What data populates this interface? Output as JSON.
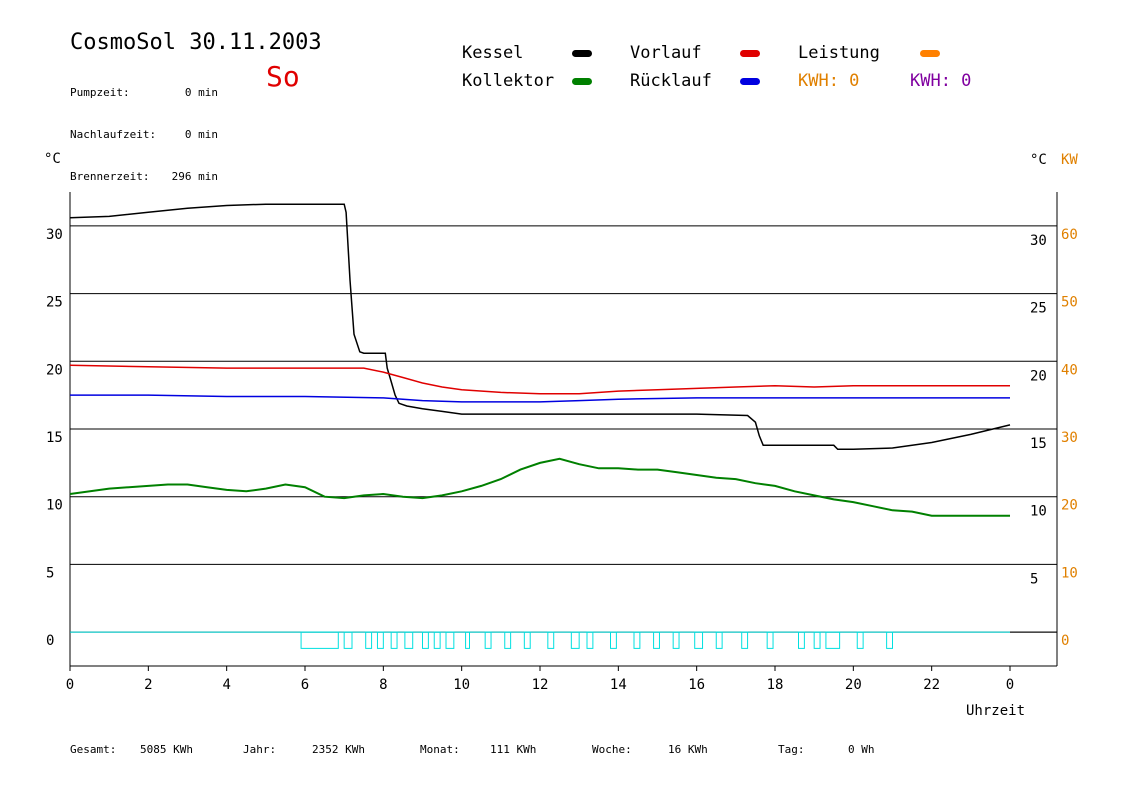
{
  "header": {
    "title": "CosmoSol 30.11.2003",
    "day": "So",
    "day_color": "#e00000",
    "stats": [
      {
        "label": "Pumpzeit:",
        "value": "0 min"
      },
      {
        "label": "Nachlaufzeit:",
        "value": "0 min"
      },
      {
        "label": "Brennerzeit:",
        "value": "296 min"
      }
    ]
  },
  "legend": {
    "items": [
      {
        "label": "Kessel",
        "color": "#000000"
      },
      {
        "label": "Vorlauf",
        "color": "#e00000"
      },
      {
        "label": "Leistung",
        "color": "#ff8000"
      },
      {
        "label": "Kollektor",
        "color": "#008000"
      },
      {
        "label": "Rücklauf",
        "color": "#0000e0"
      }
    ],
    "kwh1": {
      "label": "KWH: 0",
      "color": "#e08000"
    },
    "kwh2": {
      "label": "KWH: 0",
      "color": "#8000a0"
    }
  },
  "totals": [
    {
      "label": "Gesamt:",
      "value": "5085 KWh"
    },
    {
      "label": "Jahr:",
      "value": "2352 KWh"
    },
    {
      "label": "Monat:",
      "value": "111 KWh"
    },
    {
      "label": "Woche:",
      "value": "16 KWh"
    },
    {
      "label": "Tag:",
      "value": "0 Wh"
    }
  ],
  "chart_data": {
    "type": "line",
    "xlabel": "Uhrzeit",
    "ylabel_left": "°C",
    "ylabel_right": "°C",
    "ylabel_right2": "KW",
    "xlim": [
      0,
      24
    ],
    "ylim": [
      -2.5,
      32.5
    ],
    "y2lim": [
      -5,
      65
    ],
    "x_ticks": [
      0,
      2,
      4,
      6,
      8,
      10,
      12,
      14,
      16,
      18,
      20,
      22,
      24
    ],
    "x_tick_labels": [
      "0",
      "2",
      "4",
      "6",
      "8",
      "10",
      "12",
      "14",
      "16",
      "18",
      "20",
      "22",
      "0"
    ],
    "y_ticks": [
      0,
      5,
      10,
      15,
      20,
      25,
      30
    ],
    "y2_ticks": [
      0,
      10,
      20,
      30,
      40,
      50,
      60
    ],
    "grid": true,
    "colors": {
      "kw_axis": "#e08000"
    },
    "series": [
      {
        "name": "Kessel",
        "color": "#000000",
        "x": [
          0,
          1,
          2,
          3,
          4,
          5,
          6,
          7.0,
          7.05,
          7.15,
          7.25,
          7.4,
          7.5,
          8.05,
          8.1,
          8.2,
          8.3,
          8.4,
          8.6,
          9.0,
          9.5,
          10,
          12,
          14,
          16,
          17.3,
          17.5,
          17.6,
          17.7,
          18,
          19,
          19.5,
          19.6,
          20,
          21,
          22,
          23,
          24
        ],
        "y": [
          30.6,
          30.7,
          31.0,
          31.3,
          31.5,
          31.6,
          31.6,
          31.6,
          31.0,
          26,
          22,
          20.7,
          20.6,
          20.6,
          19.5,
          18.5,
          17.5,
          16.9,
          16.7,
          16.5,
          16.3,
          16.1,
          16.1,
          16.1,
          16.1,
          16.0,
          15.5,
          14.5,
          13.8,
          13.8,
          13.8,
          13.8,
          13.5,
          13.5,
          13.6,
          14.0,
          14.6,
          15.3
        ]
      },
      {
        "name": "Vorlauf",
        "color": "#e00000",
        "x": [
          0,
          2,
          4,
          6,
          7,
          7.5,
          8,
          8.5,
          9,
          9.5,
          10,
          11,
          12,
          13,
          14,
          15,
          16,
          17,
          18,
          19,
          20,
          21,
          22,
          23,
          24
        ],
        "y": [
          19.7,
          19.6,
          19.5,
          19.5,
          19.5,
          19.5,
          19.2,
          18.8,
          18.4,
          18.1,
          17.9,
          17.7,
          17.6,
          17.6,
          17.8,
          17.9,
          18.0,
          18.1,
          18.2,
          18.1,
          18.2,
          18.2,
          18.2,
          18.2,
          18.2
        ]
      },
      {
        "name": "Rücklauf",
        "color": "#0000e0",
        "x": [
          0,
          2,
          4,
          6,
          8,
          8.5,
          9,
          10,
          11,
          12,
          13,
          14,
          16,
          18,
          20,
          22,
          24
        ],
        "y": [
          17.5,
          17.5,
          17.4,
          17.4,
          17.3,
          17.2,
          17.1,
          17.0,
          17.0,
          17.0,
          17.1,
          17.2,
          17.3,
          17.3,
          17.3,
          17.3,
          17.3
        ]
      },
      {
        "name": "Kollektor",
        "color": "#008000",
        "x": [
          0,
          1,
          2,
          2.5,
          3,
          3.5,
          4,
          4.5,
          5,
          5.5,
          6,
          6.5,
          7,
          7.5,
          8,
          8.5,
          9,
          9.5,
          10,
          10.5,
          11,
          11.5,
          12,
          12.5,
          13,
          13.5,
          14,
          14.5,
          15,
          15.5,
          16,
          16.5,
          17,
          17.5,
          18,
          18.5,
          19,
          19.5,
          20,
          20.5,
          21,
          21.5,
          22,
          22.5,
          23,
          23.5,
          24
        ],
        "y": [
          10.2,
          10.6,
          10.8,
          10.9,
          10.9,
          10.7,
          10.5,
          10.4,
          10.6,
          10.9,
          10.7,
          10.0,
          9.9,
          10.1,
          10.2,
          10.0,
          9.9,
          10.1,
          10.4,
          10.8,
          11.3,
          12.0,
          12.5,
          12.8,
          12.4,
          12.1,
          12.1,
          12.0,
          12.0,
          11.8,
          11.6,
          11.4,
          11.3,
          11.0,
          10.8,
          10.4,
          10.1,
          9.8,
          9.6,
          9.3,
          9.0,
          8.9,
          8.6,
          8.6,
          8.6,
          8.6,
          8.6
        ]
      }
    ],
    "pump_pulses": {
      "name": "Pumpe",
      "color": "#00e0e0",
      "baseline": 0,
      "height": -1.2,
      "intervals": [
        [
          5.9,
          6.85
        ],
        [
          7.0,
          7.2
        ],
        [
          7.55,
          7.7
        ],
        [
          7.85,
          8.0
        ],
        [
          8.2,
          8.35
        ],
        [
          8.55,
          8.75
        ],
        [
          9.0,
          9.15
        ],
        [
          9.3,
          9.45
        ],
        [
          9.6,
          9.8
        ],
        [
          10.1,
          10.2
        ],
        [
          10.6,
          10.75
        ],
        [
          11.1,
          11.25
        ],
        [
          11.6,
          11.75
        ],
        [
          12.2,
          12.35
        ],
        [
          12.8,
          13.0
        ],
        [
          13.2,
          13.35
        ],
        [
          13.8,
          13.95
        ],
        [
          14.4,
          14.55
        ],
        [
          14.9,
          15.05
        ],
        [
          15.4,
          15.55
        ],
        [
          15.95,
          16.15
        ],
        [
          16.5,
          16.65
        ],
        [
          17.15,
          17.3
        ],
        [
          17.8,
          17.95
        ],
        [
          18.6,
          18.75
        ],
        [
          19.0,
          19.15
        ],
        [
          19.3,
          19.65
        ],
        [
          20.1,
          20.25
        ],
        [
          20.85,
          21.0
        ]
      ]
    }
  }
}
